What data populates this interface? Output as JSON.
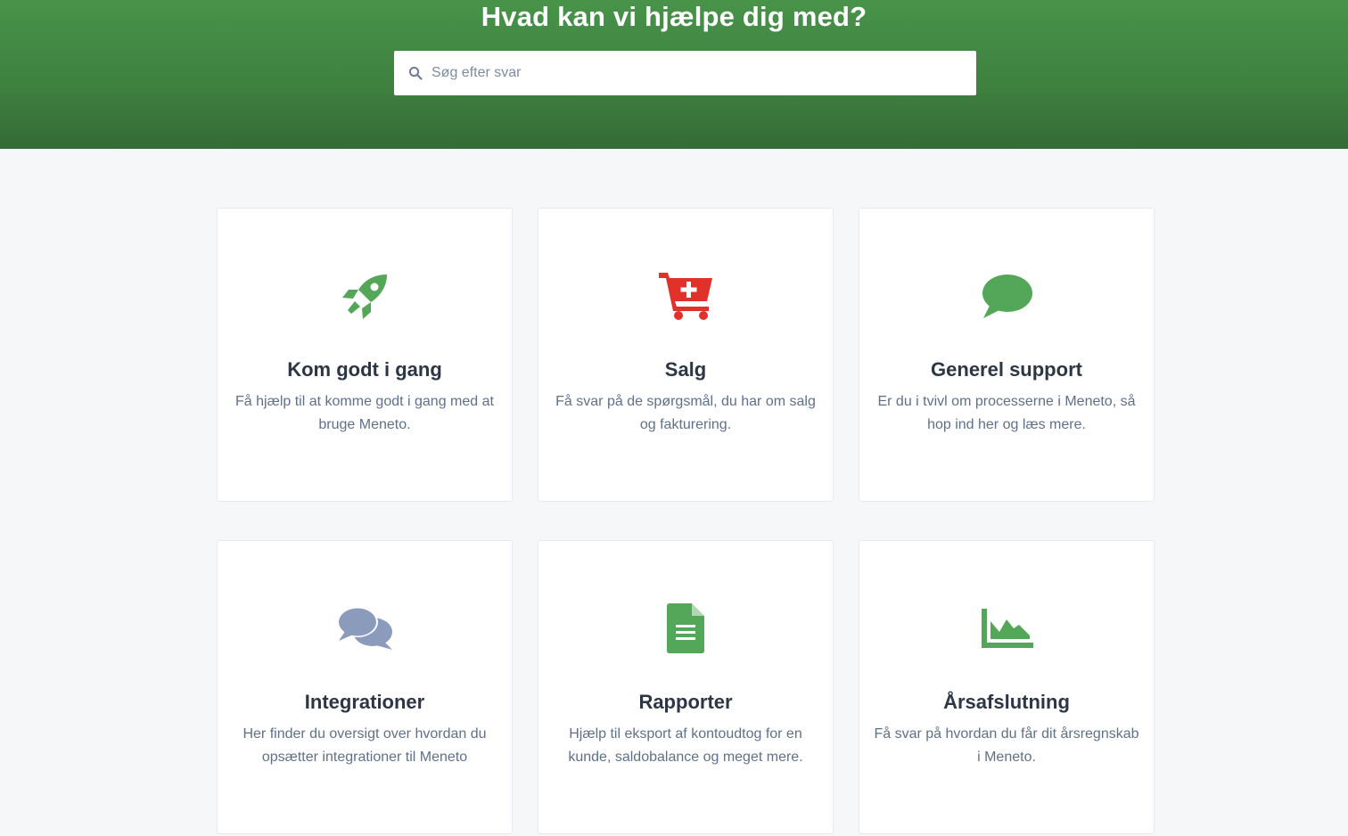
{
  "hero": {
    "title": "Hvad kan vi hjælpe dig med?",
    "search_placeholder": "Søg efter svar",
    "search_value": ""
  },
  "colors": {
    "hero_green": "#3f8240",
    "icon_green": "#54a758",
    "icon_red": "#e0322b",
    "icon_blue_gray": "#8a9bbb"
  },
  "categories": [
    {
      "title": "Kom godt i gang",
      "description": "Få hjælp til at komme godt i gang med at bruge Meneto.",
      "icon": "rocket-icon"
    },
    {
      "title": "Salg",
      "description": "Få svar på de spørgsmål, du har om salg og fakturering.",
      "icon": "cart-plus-icon"
    },
    {
      "title": "Generel support",
      "description": "Er du i tvivl om processerne i Meneto, så hop ind her og læs mere.",
      "icon": "comment-icon"
    },
    {
      "title": "Integrationer",
      "description": "Her finder du oversigt over hvordan du opsætter integrationer til Meneto",
      "icon": "comments-icon"
    },
    {
      "title": "Rapporter",
      "description": "Hjælp til eksport af kontoudtog for en kunde, saldobalance og meget mere.",
      "icon": "document-icon"
    },
    {
      "title": "Årsafslutning",
      "description": "Få svar på hvordan du får dit årsregnskab i Meneto.",
      "icon": "area-chart-icon"
    }
  ]
}
